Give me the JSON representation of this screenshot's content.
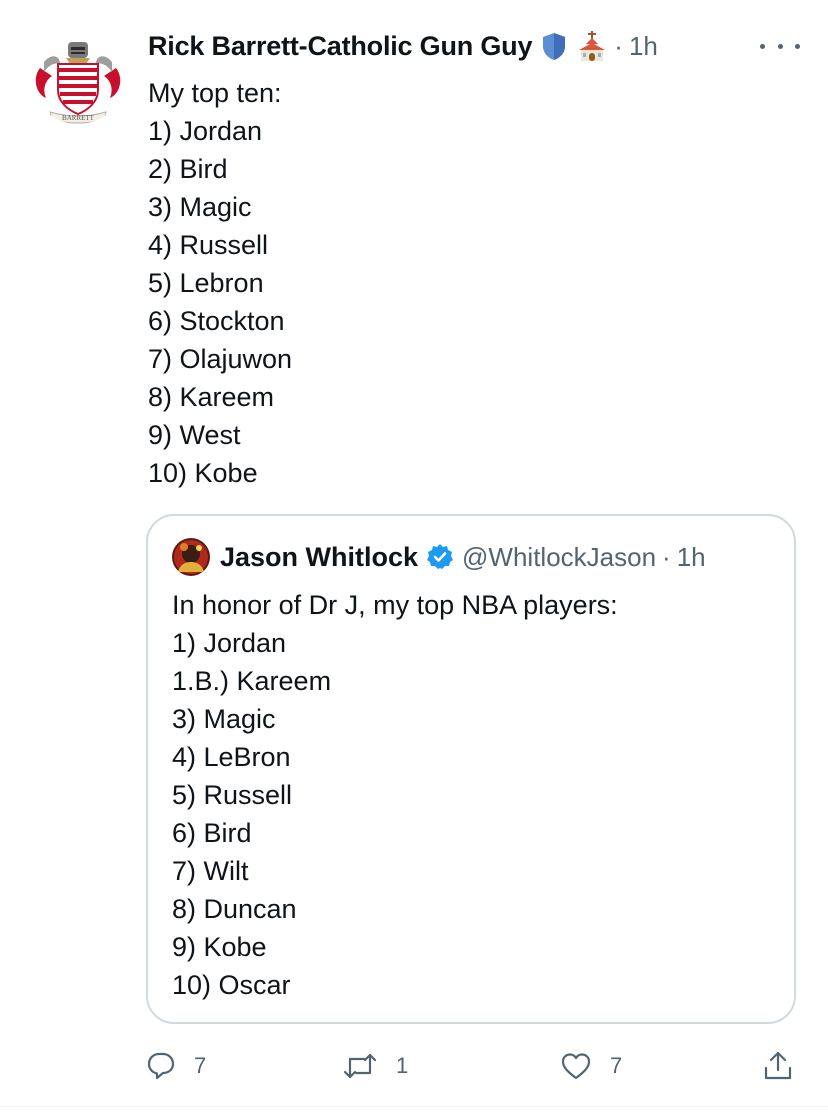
{
  "tweet": {
    "display_name": "Rick Barrett-Catholic Gun Guy",
    "header_icons": [
      "shield-icon",
      "church-icon"
    ],
    "avatar_caption": "BARRETT",
    "separator": "·",
    "timestamp": "1h",
    "lines": [
      "My top ten:",
      "1) Jordan",
      "2) Bird",
      "3) Magic",
      "4) Russell",
      "5) Lebron",
      "6) Stockton",
      "7) Olajuwon",
      "8) Kareem",
      "9) West",
      "10) Kobe"
    ]
  },
  "quoted_tweet": {
    "display_name": "Jason Whitlock",
    "verified": true,
    "handle": "@WhitlockJason",
    "separator": "·",
    "timestamp": "1h",
    "lines": [
      "In honor of Dr J, my top NBA players:",
      "1) Jordan",
      "1.B.) Kareem",
      "3) Magic",
      "4) LeBron",
      "5) Russell",
      "6) Bird",
      "7) Wilt",
      "8) Duncan",
      "9) Kobe",
      "10) Oscar"
    ]
  },
  "actions": {
    "reply_count": "7",
    "retweet_count": "1",
    "like_count": "7"
  },
  "colors": {
    "text": "#0f1419",
    "secondary": "#536471",
    "border": "#cfd9de",
    "verified": "#1d9bf0",
    "shield": "#5b8ed6",
    "crest_red": "#c8102e"
  }
}
